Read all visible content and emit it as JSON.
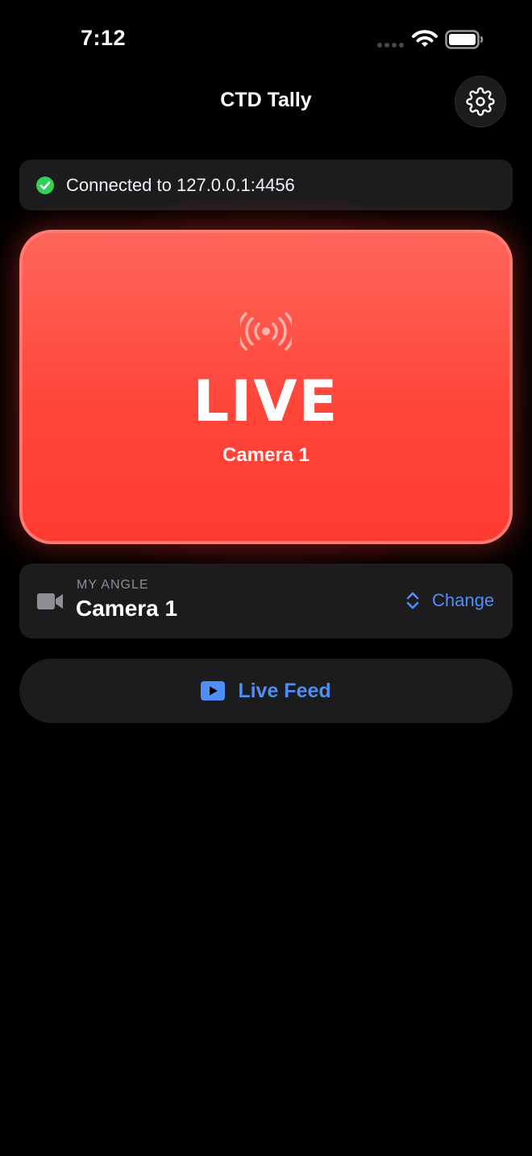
{
  "status_bar": {
    "time": "7:12"
  },
  "header": {
    "title": "CTD Tally",
    "settings_icon": "gear-icon"
  },
  "connection": {
    "text": "Connected to 127.0.0.1:4456",
    "icon": "checkmark-circle-icon",
    "status_color": "#30d158"
  },
  "tally": {
    "status": "LIVE",
    "camera": "Camera 1",
    "icon": "broadcast-icon",
    "color": "#ff3b30"
  },
  "angle": {
    "caption": "MY ANGLE",
    "value": "Camera 1",
    "icon": "video-camera-icon",
    "change_label": "Change",
    "change_icon": "chevron-up-down-icon"
  },
  "live_feed": {
    "label": "Live Feed",
    "icon": "play-rectangle-icon",
    "accent": "#4f8ef7"
  }
}
